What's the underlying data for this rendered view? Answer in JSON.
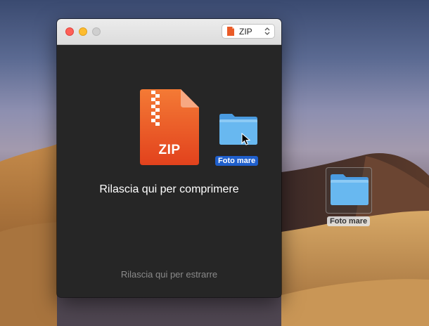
{
  "window": {
    "format_selector": {
      "selected": "ZIP"
    },
    "archive_icon_label": "ZIP",
    "drop_compress_text": "Rilascia qui per comprimere",
    "drop_extract_text": "Rilascia qui per estrarre",
    "dragged_folder": {
      "label": "Foto mare",
      "icon": "folder-icon"
    }
  },
  "desktop": {
    "folder": {
      "label": "Foto mare",
      "icon": "folder-icon"
    }
  },
  "colors": {
    "zip_orange": "#f06a2e",
    "folder_blue": "#5fb0ea",
    "selection_blue": "#1f5fcc",
    "window_bg": "#262626"
  }
}
